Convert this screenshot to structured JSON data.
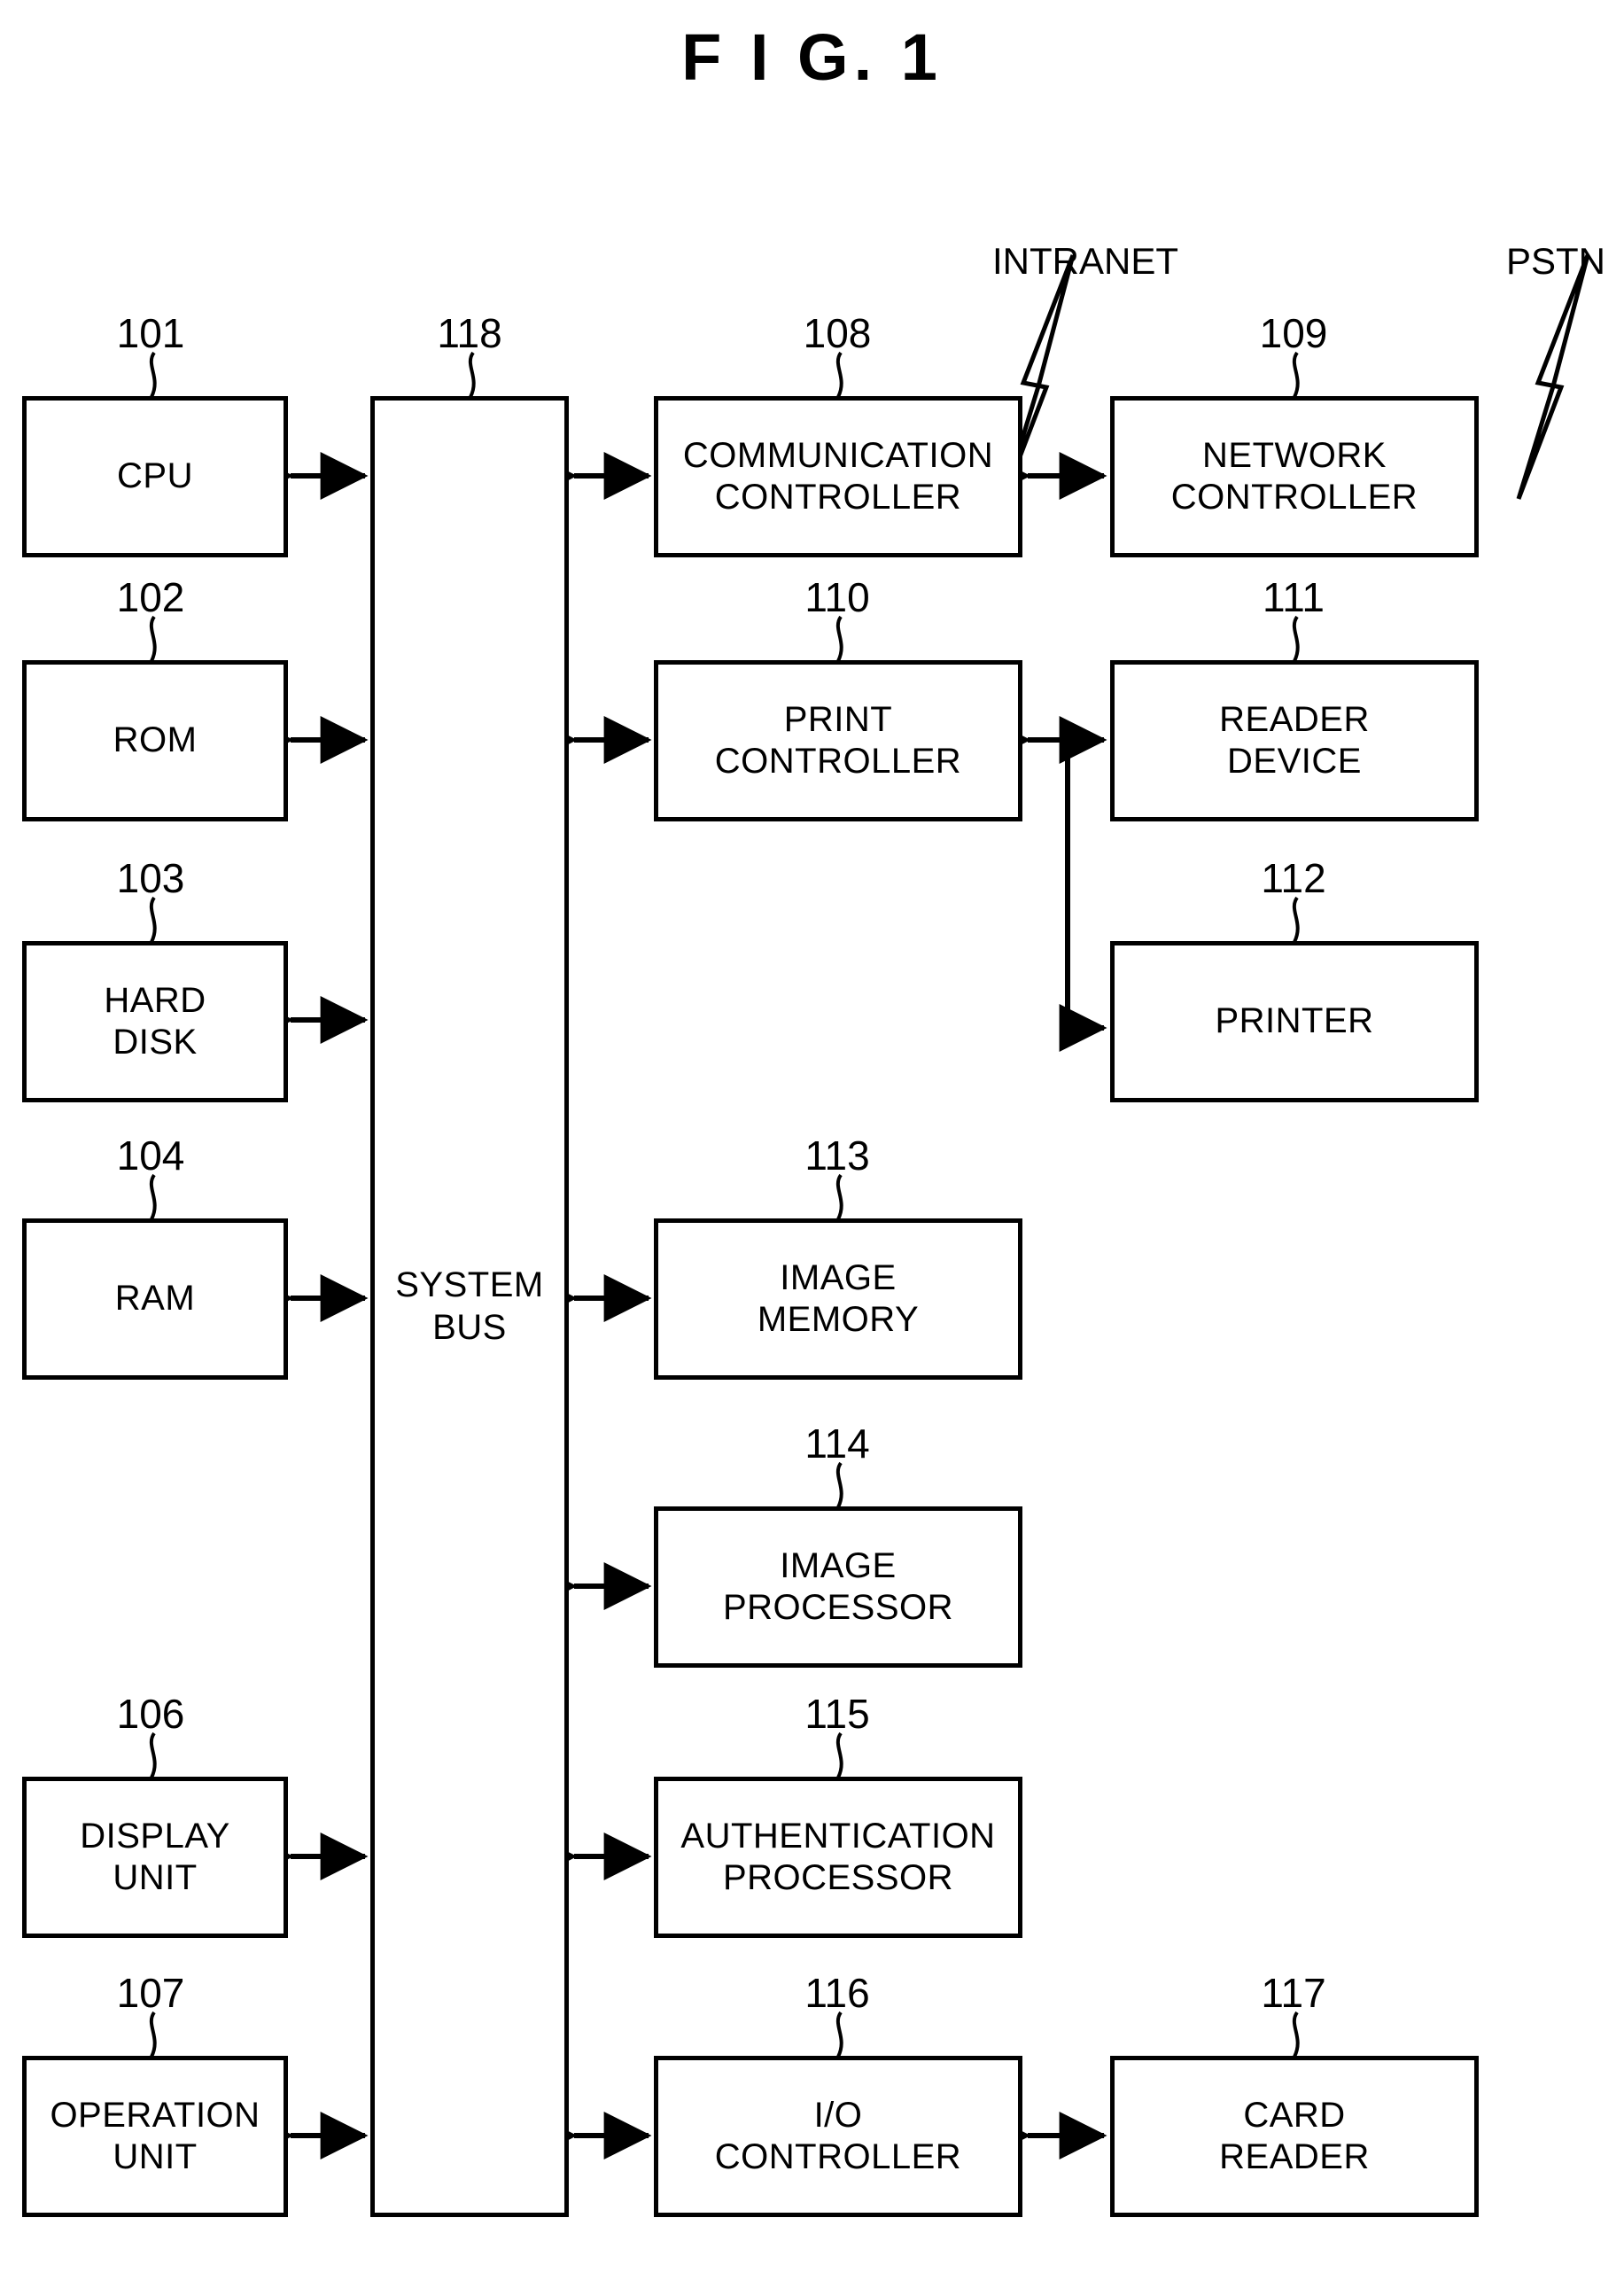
{
  "figure": {
    "title": "F I G.  1"
  },
  "network_labels": {
    "intranet": "INTRANET",
    "pstn": "PSTN"
  },
  "blocks": [
    {
      "id": "cpu",
      "ref": "101",
      "label": "CPU"
    },
    {
      "id": "rom",
      "ref": "102",
      "label": "ROM"
    },
    {
      "id": "hard-disk",
      "ref": "103",
      "label": "HARD\nDISK"
    },
    {
      "id": "ram",
      "ref": "104",
      "label": "RAM"
    },
    {
      "id": "display-unit",
      "ref": "106",
      "label": "DISPLAY\nUNIT"
    },
    {
      "id": "operation-unit",
      "ref": "107",
      "label": "OPERATION\nUNIT"
    },
    {
      "id": "communication-controller",
      "ref": "108",
      "label": "COMMUNICATION\nCONTROLLER"
    },
    {
      "id": "network-controller",
      "ref": "109",
      "label": "NETWORK\nCONTROLLER"
    },
    {
      "id": "print-controller",
      "ref": "110",
      "label": "PRINT\nCONTROLLER"
    },
    {
      "id": "reader-device",
      "ref": "111",
      "label": "READER\nDEVICE"
    },
    {
      "id": "printer",
      "ref": "112",
      "label": "PRINTER"
    },
    {
      "id": "image-memory",
      "ref": "113",
      "label": "IMAGE\nMEMORY"
    },
    {
      "id": "image-processor",
      "ref": "114",
      "label": "IMAGE\nPROCESSOR"
    },
    {
      "id": "authentication-processor",
      "ref": "115",
      "label": "AUTHENTICATION\nPROCESSOR"
    },
    {
      "id": "io-controller",
      "ref": "116",
      "label": "I/O\nCONTROLLER"
    },
    {
      "id": "card-reader",
      "ref": "117",
      "label": "CARD\nREADER"
    },
    {
      "id": "system-bus",
      "ref": "118",
      "label": "SYSTEM\nBUS"
    }
  ],
  "colors": {
    "line": "#000000",
    "background": "#ffffff"
  }
}
